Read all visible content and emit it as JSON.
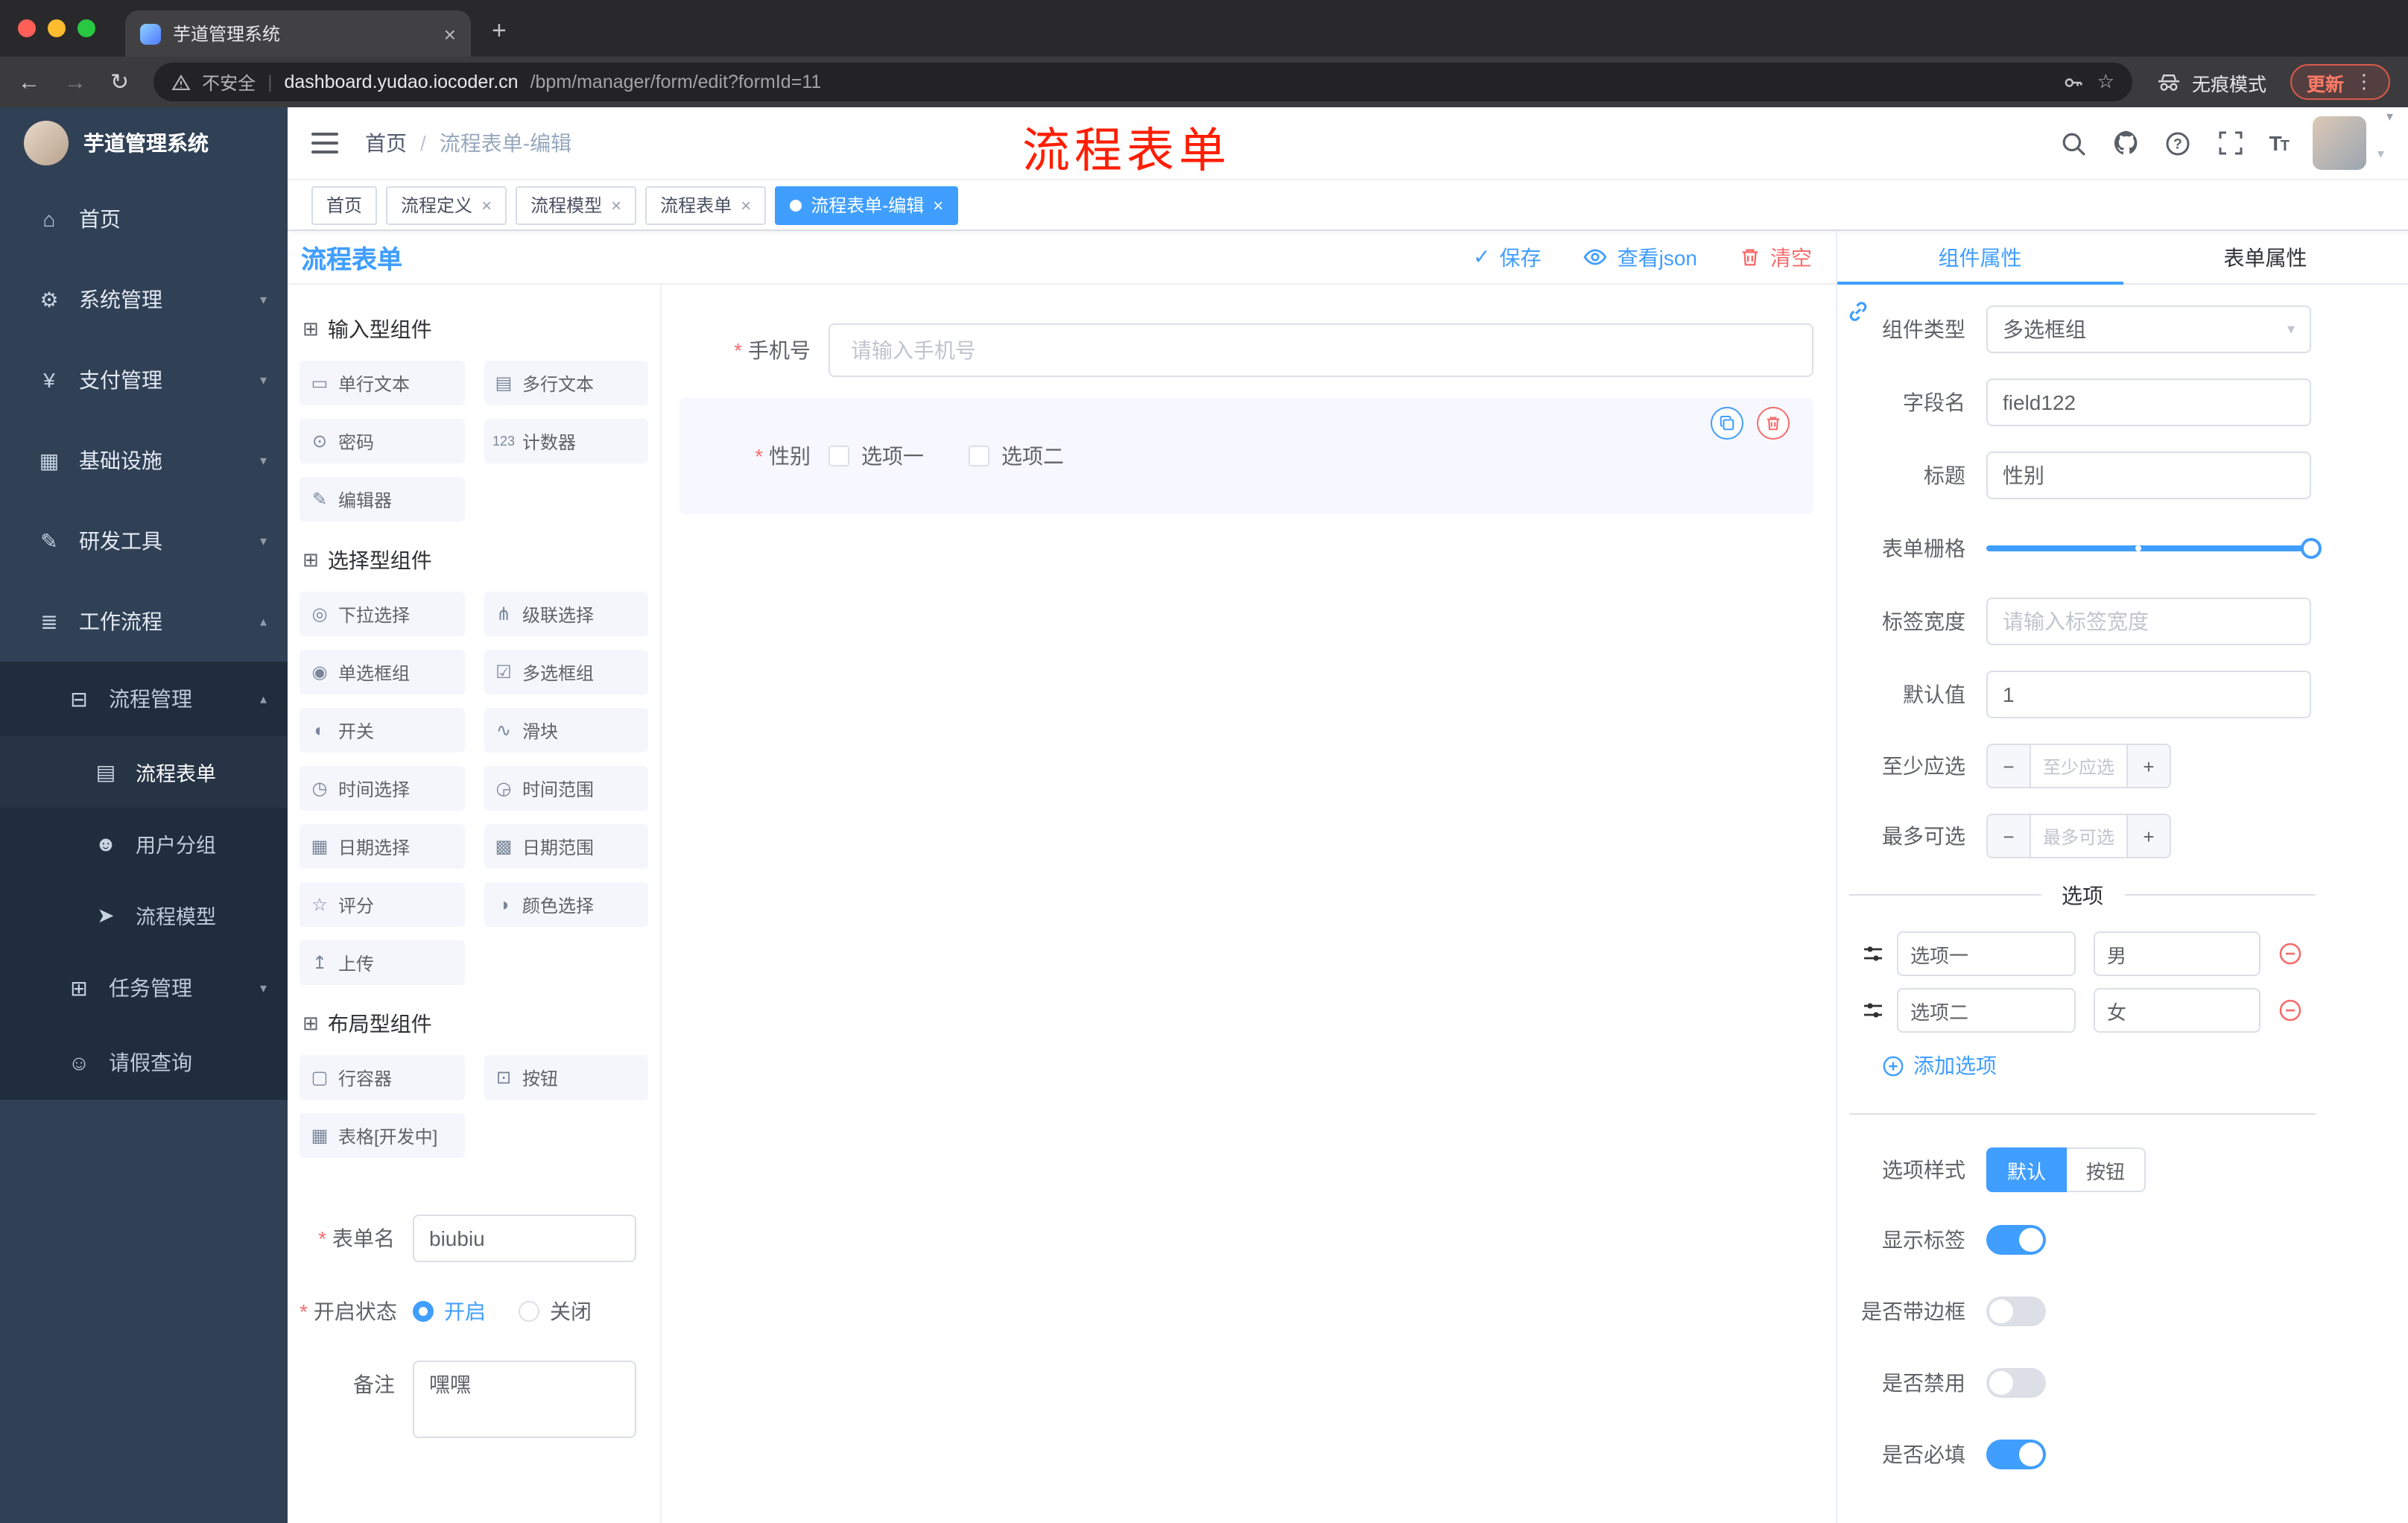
{
  "glyphs": {
    "close": "×",
    "plus": "+",
    "back": "←",
    "forward": "→",
    "reload": "↻",
    "star": "☆",
    "kebab": "⋮",
    "caret_down": "▾",
    "check": "✓",
    "sep": "|",
    "minus": "−",
    "tt_big": "T",
    "tt_small": "T"
  },
  "browser": {
    "tab_title": "芋道管理系统",
    "security_label": "不安全",
    "url_domain": "dashboard.yudao.iocoder.cn",
    "url_path": "/bpm/manager/form/edit?formId=11",
    "incognito_label": "无痕模式",
    "update_label": "更新"
  },
  "annotation": "流程表单",
  "sidebar": {
    "logo_title": "芋道管理系统",
    "items": [
      {
        "icon": "⌂",
        "label": "首页",
        "chev": ""
      },
      {
        "icon": "⚙",
        "label": "系统管理",
        "chev": "▾"
      },
      {
        "icon": "¥",
        "label": "支付管理",
        "chev": "▾"
      },
      {
        "icon": "▦",
        "label": "基础设施",
        "chev": "▾"
      },
      {
        "icon": "✎",
        "label": "研发工具",
        "chev": "▾"
      },
      {
        "icon": "≣",
        "label": "工作流程",
        "chev": "▴"
      },
      {
        "icon": "⊟",
        "label": "流程管理",
        "chev": "▴"
      },
      {
        "icon": "▤",
        "label": "流程表单",
        "chev": ""
      },
      {
        "icon": "☻",
        "label": "用户分组",
        "chev": ""
      },
      {
        "icon": "➤",
        "label": "流程模型",
        "chev": ""
      },
      {
        "icon": "⊞",
        "label": "任务管理",
        "chev": "▾"
      },
      {
        "icon": "☺",
        "label": "请假查询",
        "chev": ""
      }
    ]
  },
  "header": {
    "breadcrumb_home": "首页",
    "breadcrumb_sep": "/",
    "breadcrumb_current": "流程表单-编辑"
  },
  "tags": [
    {
      "label": "首页"
    },
    {
      "label": "流程定义"
    },
    {
      "label": "流程模型"
    },
    {
      "label": "流程表单"
    },
    {
      "label": "流程表单-编辑"
    }
  ],
  "toolbar": {
    "title": "流程表单",
    "save_label": "保存",
    "view_json_label": "查看json",
    "clear_label": "清空"
  },
  "palette": {
    "groups": [
      {
        "title": "输入型组件",
        "items": [
          {
            "icon": "▭",
            "label": "单行文本"
          },
          {
            "icon": "▤",
            "label": "多行文本"
          },
          {
            "icon": "⊙",
            "label": "密码"
          },
          {
            "icon": "123",
            "label": "计数器"
          },
          {
            "icon": "✎",
            "label": "编辑器"
          }
        ]
      },
      {
        "title": "选择型组件",
        "items": [
          {
            "icon": "◎",
            "label": "下拉选择"
          },
          {
            "icon": "⋔",
            "label": "级联选择"
          },
          {
            "icon": "◉",
            "label": "单选框组"
          },
          {
            "icon": "☑",
            "label": "多选框组"
          },
          {
            "icon": "◐",
            "label": "开关"
          },
          {
            "icon": "∿",
            "label": "滑块"
          },
          {
            "icon": "◷",
            "label": "时间选择"
          },
          {
            "icon": "◶",
            "label": "时间范围"
          },
          {
            "icon": "▦",
            "label": "日期选择"
          },
          {
            "icon": "▩",
            "label": "日期范围"
          },
          {
            "icon": "☆",
            "label": "评分"
          },
          {
            "icon": "◑",
            "label": "颜色选择"
          },
          {
            "icon": "↥",
            "label": "上传"
          }
        ]
      },
      {
        "title": "布局型组件",
        "items": [
          {
            "icon": "▢",
            "label": "行容器"
          },
          {
            "icon": "⊡",
            "label": "按钮"
          },
          {
            "icon": "▦",
            "label": "表格[开发中]"
          }
        ]
      }
    ],
    "form": {
      "name_label": "表单名",
      "name_value": "biubiu",
      "status_label": "开启状态",
      "status_on": "开启",
      "status_off": "关闭",
      "remark_label": "备注",
      "remark_value": "嘿嘿"
    }
  },
  "canvas": {
    "phone_label": "手机号",
    "phone_placeholder": "请输入手机号",
    "gender_label": "性别",
    "gender_option1": "选项一",
    "gender_option2": "选项二"
  },
  "props": {
    "tab_component": "组件属性",
    "tab_form": "表单属性",
    "component_type_label": "组件类型",
    "component_type_value": "多选框组",
    "field_name_label": "字段名",
    "field_name_value": "field122",
    "title_label": "标题",
    "title_value": "性别",
    "grid_label": "表单栅格",
    "label_width_label": "标签宽度",
    "label_width_placeholder": "请输入标签宽度",
    "default_label": "默认值",
    "default_value": "1",
    "min_label": "至少应选",
    "min_placeholder": "至少应选",
    "max_label": "最多可选",
    "max_placeholder": "最多可选",
    "options_title": "选项",
    "options": [
      {
        "label": "选项一",
        "value": "男"
      },
      {
        "label": "选项二",
        "value": "女"
      }
    ],
    "add_option_label": "添加选项",
    "style_label": "选项样式",
    "style_default": "默认",
    "style_button": "按钮",
    "show_label_label": "显示标签",
    "border_label": "是否带边框",
    "disabled_label": "是否禁用",
    "required_label": "是否必填"
  },
  "colors": {
    "primary": "#409eff",
    "danger": "#f56c6c",
    "sidebar_bg": "#304156",
    "submenu_bg": "#1f2d3d",
    "annotation_red": "#fe1e00"
  }
}
